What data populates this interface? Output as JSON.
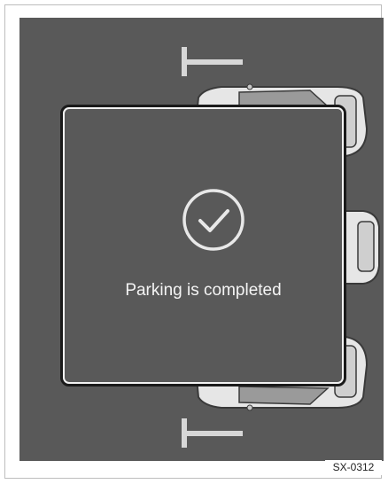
{
  "dialog": {
    "icon": "checkmark-circle-icon",
    "message": "Parking is completed"
  },
  "scene": {
    "markers": [
      "parking-marker-top",
      "parking-marker-bottom"
    ],
    "vehicles": [
      "parked-car-top",
      "parked-car-middle",
      "parked-car-bottom"
    ]
  },
  "reference_code": "SX-0312",
  "colors": {
    "background": "#595959",
    "dialog_border": "#f2f2f2",
    "text": "#f4f4f4"
  }
}
